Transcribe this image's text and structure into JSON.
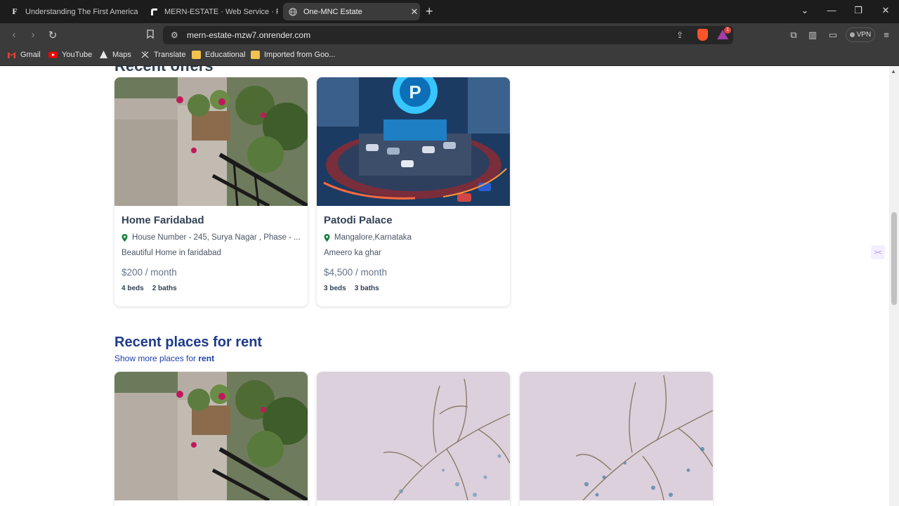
{
  "browser": {
    "tabs": [
      {
        "title": "Understanding The First American Fi",
        "favicon": "F",
        "active": false
      },
      {
        "title": "MERN-ESTATE · Web Service · Rend",
        "favicon": "render-icon",
        "active": false
      },
      {
        "title": "One-MNC Estate",
        "favicon": "globe-icon",
        "active": true
      }
    ],
    "url": "mern-estate-mzw7.onrender.com",
    "vpn_label": "VPN",
    "notification_count": "1",
    "bookmarks": [
      {
        "label": "Gmail",
        "icon": "gmail-icon"
      },
      {
        "label": "YouTube",
        "icon": "youtube-icon"
      },
      {
        "label": "Maps",
        "icon": "maps-icon"
      },
      {
        "label": "Translate",
        "icon": "translate-icon"
      },
      {
        "label": "Educational",
        "icon": "folder-icon"
      },
      {
        "label": "Imported from Goo...",
        "icon": "folder-icon"
      }
    ]
  },
  "offers": {
    "heading": "Recent offers",
    "listings": [
      {
        "name": "Home Faridabad",
        "address": "House Number - 245, Surya Nagar , Phase - ...",
        "description": "Beautiful Home in faridabad",
        "price": "$200 / month",
        "beds": "4 beds",
        "baths": "2 baths",
        "image": "balcony-plants-photo"
      },
      {
        "name": "Patodi Palace",
        "address": "Mangalore,Karnataka",
        "description": "Ameero ka ghar",
        "price": "$4,500 / month",
        "beds": "3 beds",
        "baths": "3 baths",
        "image": "parking-lot-illustration"
      }
    ]
  },
  "rent": {
    "title": "Recent places for rent",
    "link_prefix": "Show more places for ",
    "link_bold": "rent",
    "images": [
      "balcony-plants-photo",
      "bare-tree-photo",
      "bare-tree-photo"
    ]
  },
  "colors": {
    "heading": "#1e3a8a",
    "link": "#1e40af",
    "pin": "#15803d"
  }
}
